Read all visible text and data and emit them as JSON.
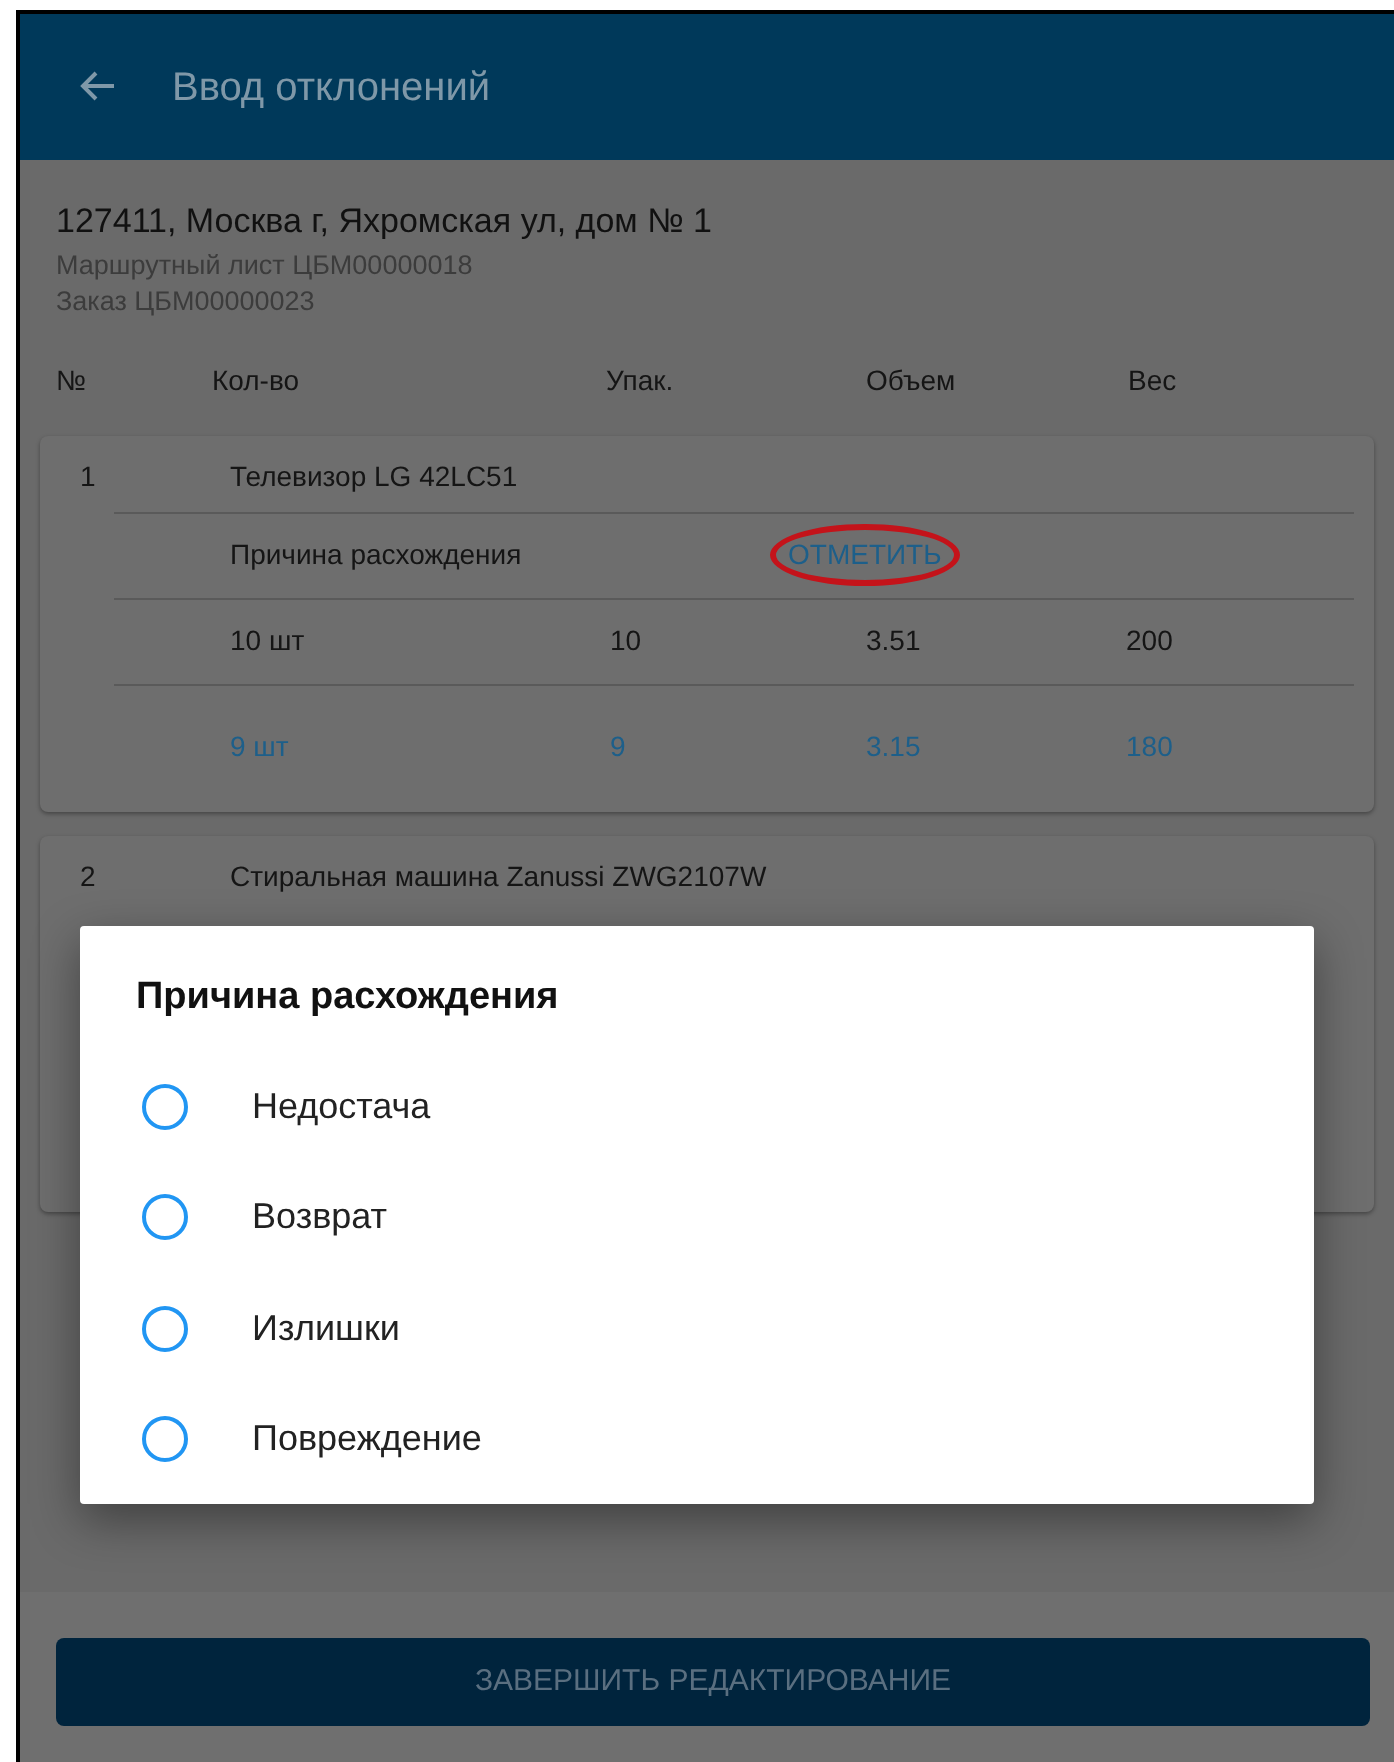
{
  "app_bar": {
    "title": "Ввод отклонений"
  },
  "address": "127411, Москва г, Яхромская ул, дом № 1",
  "route_sheet": "Маршрутный лист ЦБМ00000018",
  "order": "Заказ ЦБМ00000023",
  "columns": [
    "№",
    "Кол-во",
    "Упак.",
    "Объем",
    "Вес"
  ],
  "items": [
    {
      "number": "1",
      "name": "Телевизор LG 42LC51",
      "reason_label": "Причина расхождения",
      "reason_action": {
        "label": "ОТМЕТИТЬ",
        "circled": true
      },
      "planned": [
        "10 шт",
        "10",
        "3.51",
        "200"
      ],
      "actual": [
        "9 шт",
        "9",
        "3.15",
        "180"
      ]
    },
    {
      "number": "2",
      "name": "Стиральная машина Zanussi ZWG2107W"
    }
  ],
  "dialog": {
    "title": "Причина расхождения",
    "options": [
      {
        "label": "Недостача",
        "selected": false
      },
      {
        "label": "Возврат",
        "selected": false
      },
      {
        "label": "Излишки",
        "selected": false
      },
      {
        "label": "Повреждение",
        "selected": false
      }
    ]
  },
  "finish_button": "ЗАВЕРШИТЬ РЕДАКТИРОВАНИЕ"
}
